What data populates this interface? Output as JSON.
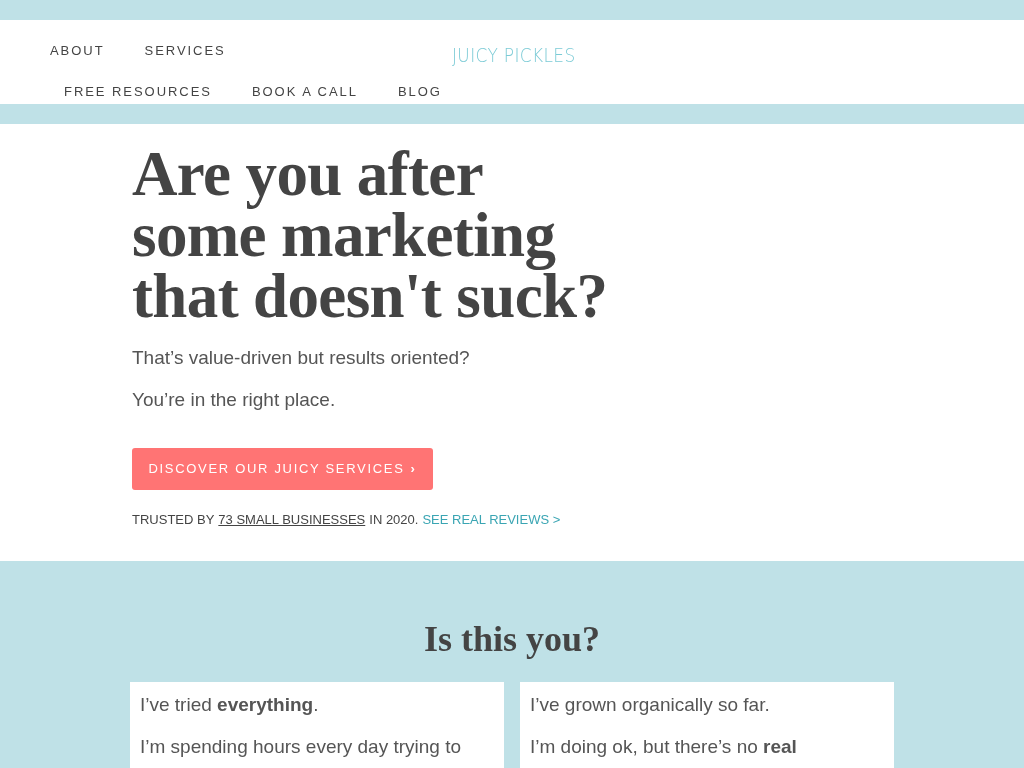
{
  "nav": {
    "row_1": [
      "ABOUT",
      "SERVICES"
    ],
    "logo": "JUICY PICKLES",
    "row_2": [
      "FREE RESOURCES",
      "BOOK A CALL",
      "BLOG"
    ]
  },
  "hero": {
    "heading_lines": [
      "Are you after",
      "some marketing",
      "that doesn't suck?"
    ],
    "paragraphs": [
      "That’s value-driven but results oriented?",
      "You’re in the right place."
    ],
    "button": {
      "label": "DISCOVER OUR JUICY SERVICES",
      "icon": "›"
    },
    "trust": {
      "prefix": "TRUSTED BY",
      "link": "73 SMALL BUSINESSES",
      "suffix": "IN 2020.",
      "reviews_link": "SEE REAL REVIEWS >"
    }
  },
  "section": {
    "heading": "Is this you?",
    "cards": [
      {
        "paragraphs": [
          "I’ve tried **everything**.",
          "I’m spending hours every day trying to"
        ]
      },
      {
        "paragraphs": [
          "I’ve grown organically so far.",
          "I’m doing ok, but there’s no **real**"
        ]
      }
    ]
  }
}
